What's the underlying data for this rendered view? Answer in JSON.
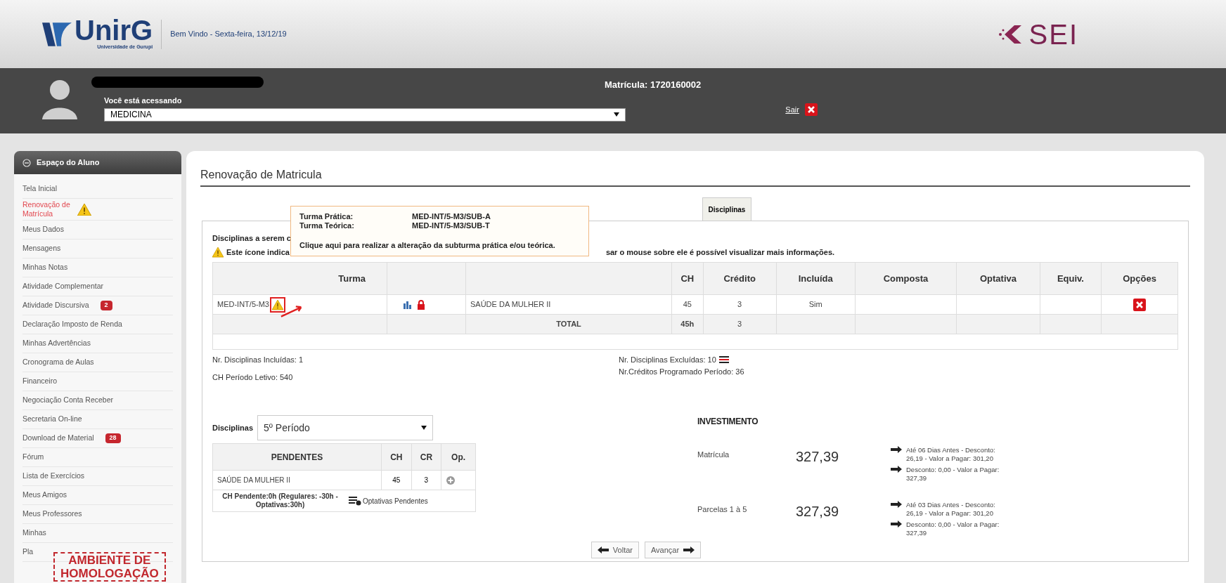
{
  "header": {
    "logo_text": "UnirG",
    "logo_subtext": "Universidade de Gurupi",
    "welcome": "Bem Vindo - Sexta-feira, 13/12/19",
    "brand_text": "SEI"
  },
  "user_bar": {
    "accessing_label": "Você está acessando",
    "course": "MEDICINA",
    "enrollment": "Matrícula: 1720160002",
    "logout": "Sair"
  },
  "sidebar": {
    "title": "Espaço do Aluno",
    "items": [
      {
        "label": "Tela Inicial",
        "selected": false,
        "warning": false
      },
      {
        "label": "Renovação de Matrícula",
        "selected": true,
        "warning": true
      },
      {
        "label": "Meus Dados",
        "selected": false,
        "warning": false
      },
      {
        "label": "Mensagens",
        "selected": false,
        "warning": false
      },
      {
        "label": "Minhas Notas",
        "selected": false,
        "warning": false
      },
      {
        "label": "Atividade Complementar",
        "selected": false,
        "warning": false
      },
      {
        "label": "Atividade Discursiva",
        "selected": false,
        "warning": false,
        "badge": "2"
      },
      {
        "label": "Declaração Imposto de Renda",
        "selected": false,
        "warning": false
      },
      {
        "label": "Minhas Advertências",
        "selected": false,
        "warning": false
      },
      {
        "label": "Cronograma de Aulas",
        "selected": false,
        "warning": false
      },
      {
        "label": "Financeiro",
        "selected": false,
        "warning": false
      },
      {
        "label": "Negociação Conta Receber",
        "selected": false,
        "warning": false
      },
      {
        "label": "Secretaria On-line",
        "selected": false,
        "warning": false
      },
      {
        "label": "Download de Material",
        "selected": false,
        "warning": false,
        "badge": "28"
      },
      {
        "label": "Fórum",
        "selected": false,
        "warning": false
      },
      {
        "label": "Lista de Exercícios",
        "selected": false,
        "warning": false
      },
      {
        "label": "Meus Amigos",
        "selected": false,
        "warning": false
      },
      {
        "label": "Meus Professores",
        "selected": false,
        "warning": false
      },
      {
        "label": "Minhas",
        "selected": false,
        "warning": false
      },
      {
        "label": "Pla",
        "selected": false,
        "warning": false
      }
    ]
  },
  "stamp": {
    "lines": [
      "AMBIENTE DE",
      "HOMOLOGAÇÃO"
    ]
  },
  "page": {
    "title": "Renovação de Matricula",
    "tabs": [
      {
        "label": "Disciplinas",
        "selected": true
      }
    ],
    "intro": "Disciplinas a serem c",
    "note_left": "Este ícone indica",
    "note_right": "sar o mouse sobre ele é possível visualizar mais informações.",
    "tooltip": {
      "rows": [
        {
          "label": "Turma Prática:",
          "value": "MED-INT/5-M3/SUB-A"
        },
        {
          "label": "Turma Teórica:",
          "value": "MED-INT/5-M3/SUB-T"
        }
      ],
      "message": "Clique aqui para realizar a alteração da subturma prática e/ou teórica."
    },
    "table": {
      "columns": [
        "Turma",
        "CH",
        "Crédito",
        "Incluída",
        "Composta",
        "Optativa",
        "Equiv.",
        "Opções"
      ],
      "rows": [
        {
          "turma": "MED-INT/5-M3",
          "warning": true,
          "disciplina": "SAÚDE DA MULHER II",
          "ch": "45",
          "credito": "3",
          "incluida": "Sim"
        }
      ],
      "total": {
        "label": "TOTAL",
        "ch": "45h",
        "credito": "3"
      }
    },
    "stats_left": [
      "Nr. Disciplinas Incluídas: 1",
      "CH Período Letivo: 540"
    ],
    "stats_right": [
      "Nr. Disciplinas Excluídas: 10",
      "Nr.Créditos Programado Período: 36"
    ],
    "pending": {
      "label": "Disciplinas",
      "period": "5º Período",
      "columns": [
        "PENDENTES",
        "CH",
        "CR",
        "Op."
      ],
      "rows": [
        {
          "name": "SAÚDE DA MULHER II",
          "ch": "45",
          "cr": "3"
        }
      ],
      "footer": "CH Pendente:0h (Regulares: -30h - Optativas:30h)",
      "optional_link": "Optativas Pendentes"
    },
    "investment": {
      "title": "INVESTIMENTO",
      "items": [
        {
          "label": "Matrícula",
          "value": "327,39",
          "options": [
            "Até 06 Dias Antes - Desconto: 26,19 - Valor a Pagar: 301,20",
            "Desconto: 0,00 - Valor a Pagar: 327,39"
          ]
        },
        {
          "label": "Parcelas 1 à 5",
          "value": "327,39",
          "options": [
            "Até 03 Dias Antes - Desconto: 26,19 - Valor a Pagar: 301,20",
            "Desconto: 0,00 - Valor a Pagar: 327,39"
          ]
        }
      ]
    },
    "buttons": [
      {
        "label": "Voltar",
        "kind": "back"
      },
      {
        "label": "Avançar",
        "kind": "next"
      }
    ]
  }
}
